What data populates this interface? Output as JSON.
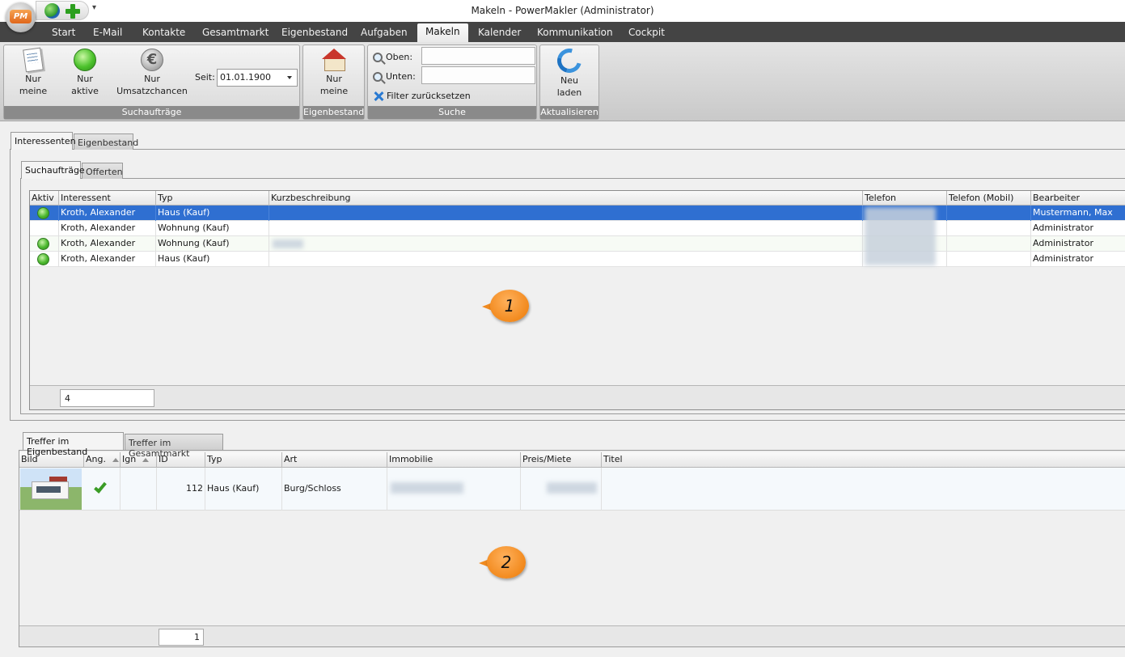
{
  "window": {
    "title": "Makeln - PowerMakler (Administrator)",
    "logo_text": "PM",
    "qat_dropdown": "▾"
  },
  "ribbon_tabs": [
    {
      "label": "Start"
    },
    {
      "label": "E-Mail"
    },
    {
      "label": "Kontakte"
    },
    {
      "label": "Gesamtmarkt"
    },
    {
      "label": "Eigenbestand"
    },
    {
      "label": "Aufgaben"
    },
    {
      "label": "Makeln",
      "active": true
    },
    {
      "label": "Kalender"
    },
    {
      "label": "Kommunikation"
    },
    {
      "label": "Cockpit"
    }
  ],
  "groups": {
    "suchauftraege": {
      "label": "Suchaufträge",
      "btn_nur_meine": {
        "line1": "Nur",
        "line2": "meine"
      },
      "btn_nur_aktive": {
        "line1": "Nur",
        "line2": "aktive"
      },
      "btn_umsatz": {
        "line1": "Nur",
        "line2": "Umsatzchancen"
      },
      "seit_label": "Seit:",
      "seit_value": "01.01.1900"
    },
    "eigenbestand": {
      "label": "Eigenbestand",
      "btn_nur_meine": {
        "line1": "Nur",
        "line2": "meine"
      }
    },
    "suche": {
      "label": "Suche",
      "oben_label": "Oben:",
      "unten_label": "Unten:",
      "reset_label": "Filter zurücksetzen"
    },
    "aktualisieren": {
      "label": "Aktualisieren",
      "btn_neu": {
        "line1": "Neu",
        "line2": "laden"
      }
    }
  },
  "outer_tabs": {
    "interessenten": "Interessenten",
    "eigenbestand": "Eigenbestand"
  },
  "inner_tabs": {
    "suchauftraege": "Suchaufträge",
    "offerten": "Offerten"
  },
  "grid1": {
    "columns": [
      "Aktiv",
      "Interessent",
      "Typ",
      "Kurzbeschreibung",
      "Telefon",
      "Telefon (Mobil)",
      "Bearbeiter"
    ],
    "rows": [
      {
        "aktiv": true,
        "interessent": "Kroth, Alexander",
        "typ": "Haus (Kauf)",
        "bearbeiter": "Mustermann, Max",
        "selected": true
      },
      {
        "aktiv": false,
        "interessent": "Kroth, Alexander",
        "typ": "Wohnung (Kauf)",
        "bearbeiter": "Administrator"
      },
      {
        "aktiv": true,
        "interessent": "Kroth, Alexander",
        "typ": "Wohnung (Kauf)",
        "bearbeiter": "Administrator"
      },
      {
        "aktiv": true,
        "interessent": "Kroth, Alexander",
        "typ": "Haus (Kauf)",
        "bearbeiter": "Administrator"
      }
    ],
    "count": "4"
  },
  "callouts": {
    "one": "1",
    "two": "2"
  },
  "lower_tabs": {
    "treffer_eigen": "Treffer im Eigenbestand",
    "treffer_gesamt": "Treffer im Gesamtmarkt"
  },
  "grid2": {
    "columns": [
      "Bild",
      "Ang.",
      "Ign",
      "ID",
      "Typ",
      "Art",
      "Immobilie",
      "Preis/Miete",
      "Titel"
    ],
    "rows": [
      {
        "id": "112",
        "typ": "Haus (Kauf)",
        "art": "Burg/Schloss"
      }
    ],
    "count": "1"
  }
}
